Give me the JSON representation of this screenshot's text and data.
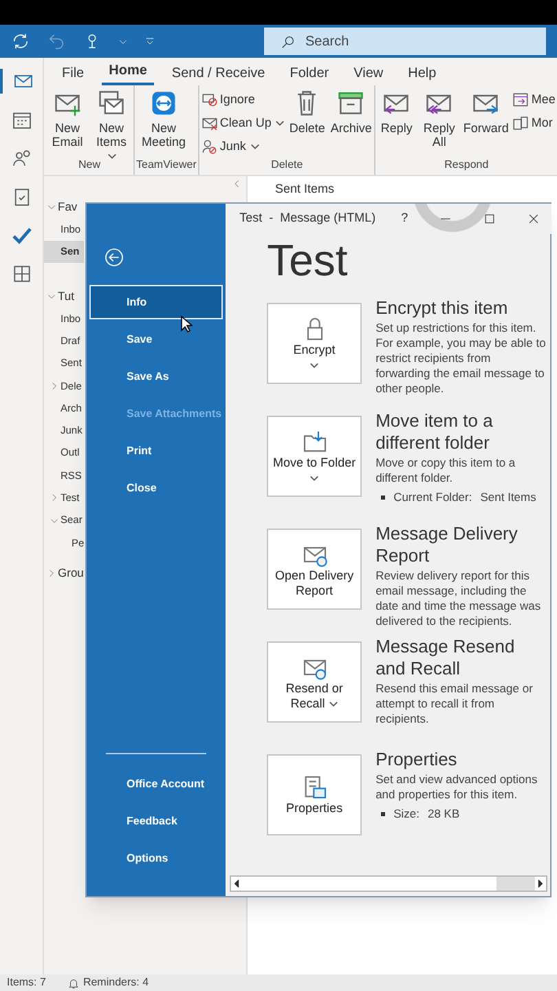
{
  "title_bar": {
    "search": {
      "placeholder": "Search"
    }
  },
  "nav_rail": [
    {
      "selected": true
    },
    {
      "selected": false
    },
    {
      "selected": false
    },
    {
      "selected": false
    },
    {
      "selected": false
    },
    {
      "selected": false
    }
  ],
  "ribbon": {
    "tabs": [
      {
        "label": "File",
        "selected": false
      },
      {
        "label": "Home",
        "selected": true
      },
      {
        "label": "Send / Receive",
        "selected": false
      },
      {
        "label": "Folder",
        "selected": false
      },
      {
        "label": "View",
        "selected": false
      },
      {
        "label": "Help",
        "selected": false
      }
    ],
    "groups": [
      {
        "label": "New",
        "buttons": [
          {
            "label": "New Email",
            "kind": "large",
            "dropdown": false
          },
          {
            "label": "New Items",
            "kind": "large",
            "dropdown": true
          }
        ]
      },
      {
        "label": "TeamViewer",
        "buttons": [
          {
            "label": "New Meeting",
            "kind": "large",
            "dropdown": false
          }
        ]
      },
      {
        "label": "Delete",
        "buttons": [
          {
            "label": "Ignore",
            "kind": "small",
            "dropdown": false
          },
          {
            "label": "Clean Up",
            "kind": "small",
            "dropdown": true
          },
          {
            "label": "Junk",
            "kind": "small",
            "dropdown": true
          },
          {
            "label": "Delete",
            "kind": "large",
            "dropdown": false
          },
          {
            "label": "Archive",
            "kind": "large",
            "dropdown": false
          }
        ]
      },
      {
        "label": "Respond",
        "buttons": [
          {
            "label": "Reply",
            "kind": "large",
            "dropdown": false
          },
          {
            "label": "Reply All",
            "kind": "large",
            "dropdown": false
          },
          {
            "label": "Forward",
            "kind": "large",
            "dropdown": false
          },
          {
            "label": "Mee",
            "kind": "small",
            "dropdown": false
          },
          {
            "label": "Mor",
            "kind": "small",
            "dropdown": false
          }
        ]
      }
    ]
  },
  "folders": [
    {
      "label": "Fav",
      "expanded": true,
      "selected": false,
      "children": [
        {
          "label": "Inbo",
          "selected": false
        },
        {
          "label": "Sen",
          "selected": true
        }
      ]
    },
    {
      "label": "Tut",
      "expanded": true,
      "selected": false,
      "children": [
        {
          "label": "Inbo",
          "selected": false
        },
        {
          "label": "Draf",
          "selected": false
        },
        {
          "label": "Sent",
          "selected": false
        },
        {
          "label": "Dele",
          "expanded": false,
          "selected": false
        },
        {
          "label": "Arch",
          "selected": false
        },
        {
          "label": "Junk",
          "selected": false
        },
        {
          "label": "Outl",
          "selected": false
        },
        {
          "label": "RSS",
          "selected": false
        },
        {
          "label": "Test",
          "expanded": false,
          "selected": false
        },
        {
          "label": "Sear",
          "expanded": true,
          "selected": false,
          "children": [
            {
              "label": "Pe",
              "selected": false
            }
          ]
        }
      ]
    },
    {
      "label": "Grou",
      "expanded": false,
      "selected": false
    }
  ],
  "message_list": {
    "title": "Sent Items"
  },
  "message_window": {
    "title": "Test  -  Message (HTML)",
    "help": "?",
    "backstage": {
      "items": [
        {
          "label": "Info",
          "selected": true,
          "disabled": false
        },
        {
          "label": "Save",
          "selected": false,
          "disabled": false
        },
        {
          "label": "Save As",
          "selected": false,
          "disabled": false
        },
        {
          "label": "Save Attachments",
          "selected": false,
          "disabled": true
        },
        {
          "label": "Print",
          "selected": false,
          "disabled": false
        },
        {
          "label": "Close",
          "selected": false,
          "disabled": false
        }
      ],
      "footer_items": [
        {
          "label": "Office Account"
        },
        {
          "label": "Feedback"
        },
        {
          "label": "Options"
        }
      ]
    },
    "heading": "Test",
    "sections": [
      {
        "button": "Encrypt",
        "dropdown": true,
        "title": "Encrypt this item",
        "description": "Set up restrictions for this item. For example, you may be able to restrict recipients from forwarding the email message to other people."
      },
      {
        "button": "Move to Folder",
        "dropdown": true,
        "title": "Move item to a different folder",
        "description": "Move or copy this item to a different folder.",
        "details": [
          {
            "label": "Current Folder:",
            "value": "Sent Items"
          }
        ]
      },
      {
        "button": "Open Delivery Report",
        "dropdown": false,
        "title": "Message Delivery Report",
        "description": "Review delivery report for this email message, including the date and time the message was delivered to the recipients."
      },
      {
        "button": "Resend or Recall",
        "dropdown": true,
        "title": "Message Resend and Recall",
        "description": "Resend this email message or attempt to recall it from recipients."
      },
      {
        "button": "Properties",
        "dropdown": false,
        "title": "Properties",
        "description": "Set and view advanced options and properties for this item.",
        "details": [
          {
            "label": "Size:",
            "value": "28 KB"
          }
        ]
      }
    ]
  },
  "status_bar": {
    "items": "Items: 7",
    "reminders": "Reminders: 4"
  }
}
